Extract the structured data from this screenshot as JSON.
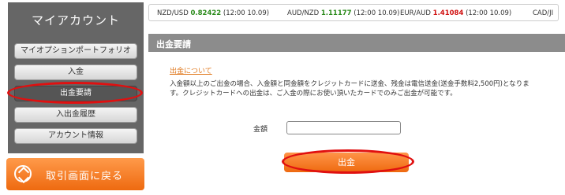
{
  "sidebar": {
    "title": "マイアカウント",
    "items": [
      {
        "label": "マイオプションポートフォリオ"
      },
      {
        "label": "入金"
      },
      {
        "label": "出金要請"
      },
      {
        "label": "入出金履歴"
      },
      {
        "label": "アカウント情報"
      }
    ],
    "back_label": "取引画面に戻る"
  },
  "ticker": [
    {
      "pair": "NZD/USD",
      "rate": "0.82422",
      "time": "(12:00 10.09)",
      "color": "#2a8a1a"
    },
    {
      "pair": "AUD/NZD",
      "rate": "1.11177",
      "time": "(12:00 10.09)",
      "color": "#2a8a1a"
    },
    {
      "pair": "EUR/AUD",
      "rate": "1.41084",
      "time": "(12:00 10.09)",
      "color": "#d01010"
    },
    {
      "pair": "CAD/JI",
      "rate": "",
      "time": "",
      "color": ""
    }
  ],
  "main": {
    "title": "出金要請",
    "about_link": "出金について",
    "description": "入金額以上のご出金の場合、入金額と同金額をクレジットカードに送金、残金は電信送金(送金手数料2,500円)となります。クレジットカードへの出金は、ご入金の際にお使い頂いたカードでのみご出金が可能です。",
    "amount_label": "金額",
    "amount_value": "",
    "submit_label": "出金"
  },
  "colors": {
    "accent": "#ee6a10",
    "sidebar_bg": "#666666",
    "highlight": "#e01010"
  }
}
